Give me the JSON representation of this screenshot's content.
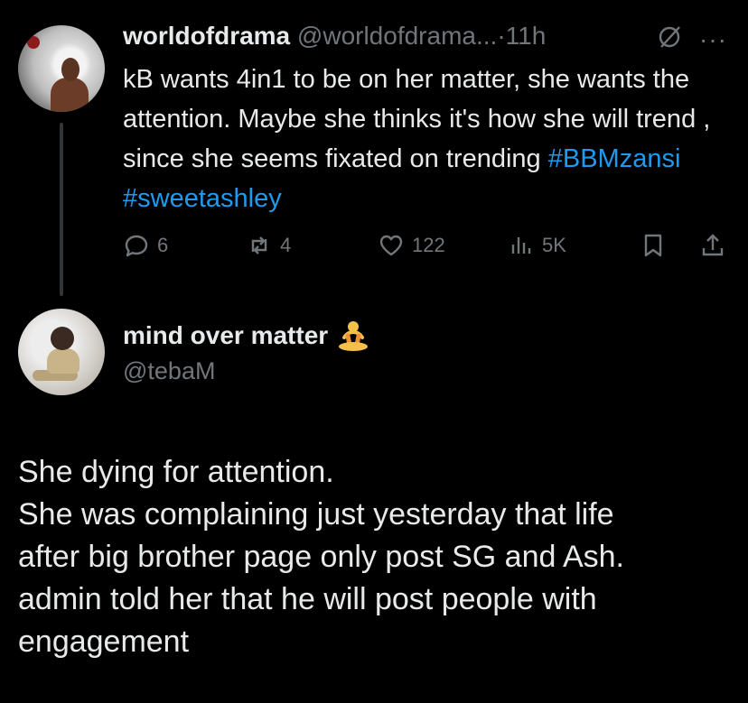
{
  "parent_tweet": {
    "display_name": "worldofdrama",
    "handle": "@worldofdrama...",
    "separator": "·",
    "time": "11h",
    "body": "kB wants 4in1 to be on her matter, she wants the attention. Maybe she thinks it's how she will trend , since she seems fixated on trending ",
    "hashtags": [
      "#BBMzansi",
      "#sweetashley"
    ],
    "stats": {
      "replies": "6",
      "reposts": "4",
      "likes": "122",
      "views": "5K"
    }
  },
  "reply_tweet": {
    "display_name": "mind over matter",
    "handle": "@tebaM",
    "lines": [
      "She dying for attention.",
      "She was complaining just yesterday that life",
      "after big brother page only post SG and Ash.",
      "admin told her that he will post people with",
      "engagement"
    ]
  },
  "icons": {
    "reply": "reply-icon",
    "repost": "repost-icon",
    "like": "heart-icon",
    "views": "views-icon",
    "bookmark": "bookmark-icon",
    "share": "share-icon",
    "more": "more-icon",
    "mute": "slash-circle-icon",
    "emoji": "meditation-emoji-icon"
  },
  "colors": {
    "background": "#000000",
    "text": "#e7e9ea",
    "muted": "#71767b",
    "link": "#1d9bf0"
  }
}
